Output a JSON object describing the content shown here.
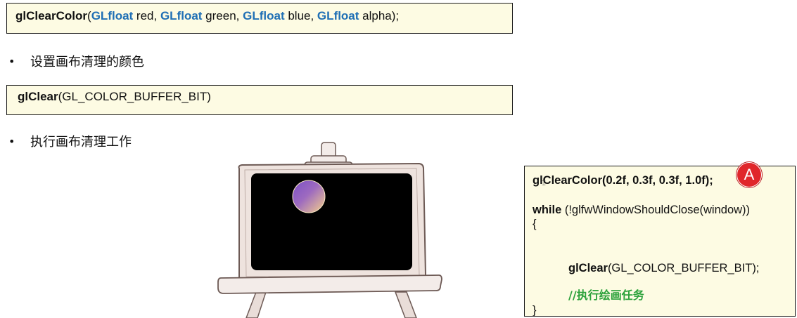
{
  "box1": {
    "fn": "glClearColor",
    "paren_open": "(",
    "t1": "GLfloat",
    "p1": " red, ",
    "t2": "GLfloat",
    "p2": " green, ",
    "t3": "GLfloat",
    "p3": " blue, ",
    "t4": "GLfloat",
    "p4": " alpha);"
  },
  "bullet1": {
    "dot": "•",
    "text": "设置画布清理的颜色"
  },
  "box2": {
    "fn": "glClear",
    "args": "(GL_COLOR_BUFFER_BIT)"
  },
  "bullet2": {
    "dot": "•",
    "text": "执行画布清理工作"
  },
  "code_panel": {
    "line1": "glClearColor(0.2f, 0.3f, 0.3f, 1.0f);",
    "line2_kw": "while",
    "line2_rest": " (!glfwWindowShouldClose(window))",
    "line3": "{",
    "line4_fn": "glClear",
    "line4_rest": "(GL_COLOR_BUFFER_BIT);",
    "line5_comment": "//执行绘画任务",
    "line6": "}"
  },
  "badge": {
    "label": "A"
  },
  "colors": {
    "keyword": "#1f6fb5",
    "comment": "#2aa13a",
    "code_bg": "#fdfbe3",
    "badge": "#e0262a",
    "board_frame": "#eee3de",
    "orb_top": "#7b4fc4",
    "orb_bottom": "#f3c98a"
  },
  "icons": {
    "cursor": "text-cursor-icon"
  }
}
